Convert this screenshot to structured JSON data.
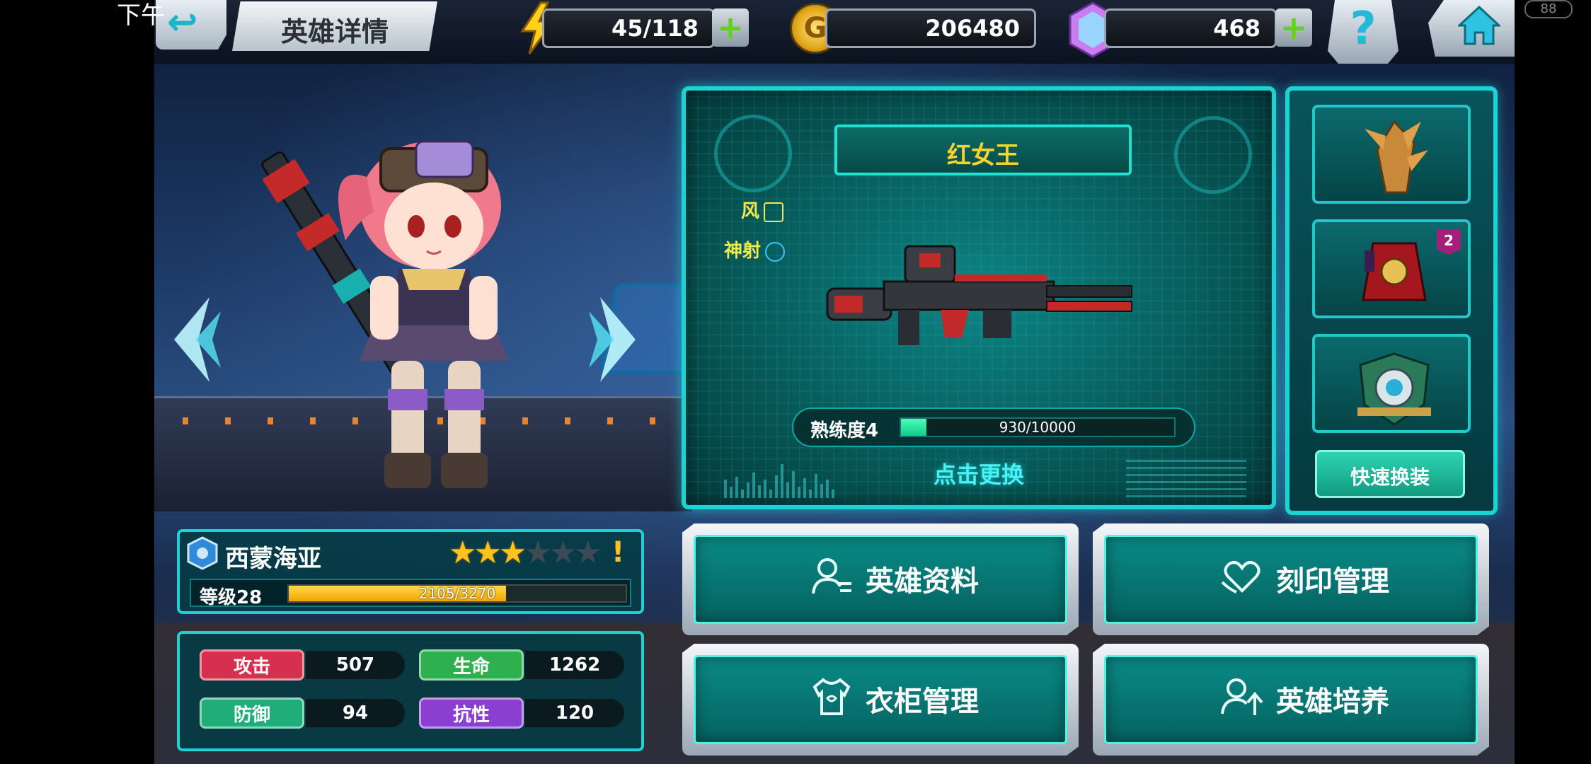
{
  "status": {
    "time": "下午",
    "battery": "88"
  },
  "header": {
    "title": "英雄详情"
  },
  "resources": {
    "energy": "45/118",
    "gold": "206480",
    "gems": "468",
    "gold_symbol": "G"
  },
  "buttons": {
    "plus": "+",
    "help": "?"
  },
  "weapon": {
    "name": "红女王",
    "tags": [
      {
        "label": "风"
      },
      {
        "label": "神射"
      }
    ],
    "mastery_label": "熟练度4",
    "mastery_value": "930/10000",
    "mastery_progress": 0.093,
    "change_label": "点击更换"
  },
  "equipment": {
    "slots": [
      {
        "item": "spiked-claw",
        "badge": ""
      },
      {
        "item": "red-armor",
        "badge": "2"
      },
      {
        "item": "shield-emblem",
        "badge": ""
      }
    ],
    "quick_equip_label": "快速换装"
  },
  "hero": {
    "name": "西蒙海亚",
    "stars_total": 6,
    "stars_filled": 3,
    "warning": "!",
    "level_label": "等级28",
    "exp_value": "2105/3270",
    "exp_progress": 0.644
  },
  "stats": [
    {
      "label": "攻击",
      "value": "507",
      "color": "#d7304f"
    },
    {
      "label": "生命",
      "value": "1262",
      "color": "#2fb04f"
    },
    {
      "label": "防御",
      "value": "94",
      "color": "#1fae7a"
    },
    {
      "label": "抗性",
      "value": "120",
      "color": "#8a3fd1"
    }
  ],
  "actions": [
    {
      "label": "英雄资料",
      "icon": "person-icon"
    },
    {
      "label": "刻印管理",
      "icon": "heart-hands-icon"
    },
    {
      "label": "衣柜管理",
      "icon": "shirt-icon"
    },
    {
      "label": "英雄培养",
      "icon": "person-up-icon"
    }
  ]
}
